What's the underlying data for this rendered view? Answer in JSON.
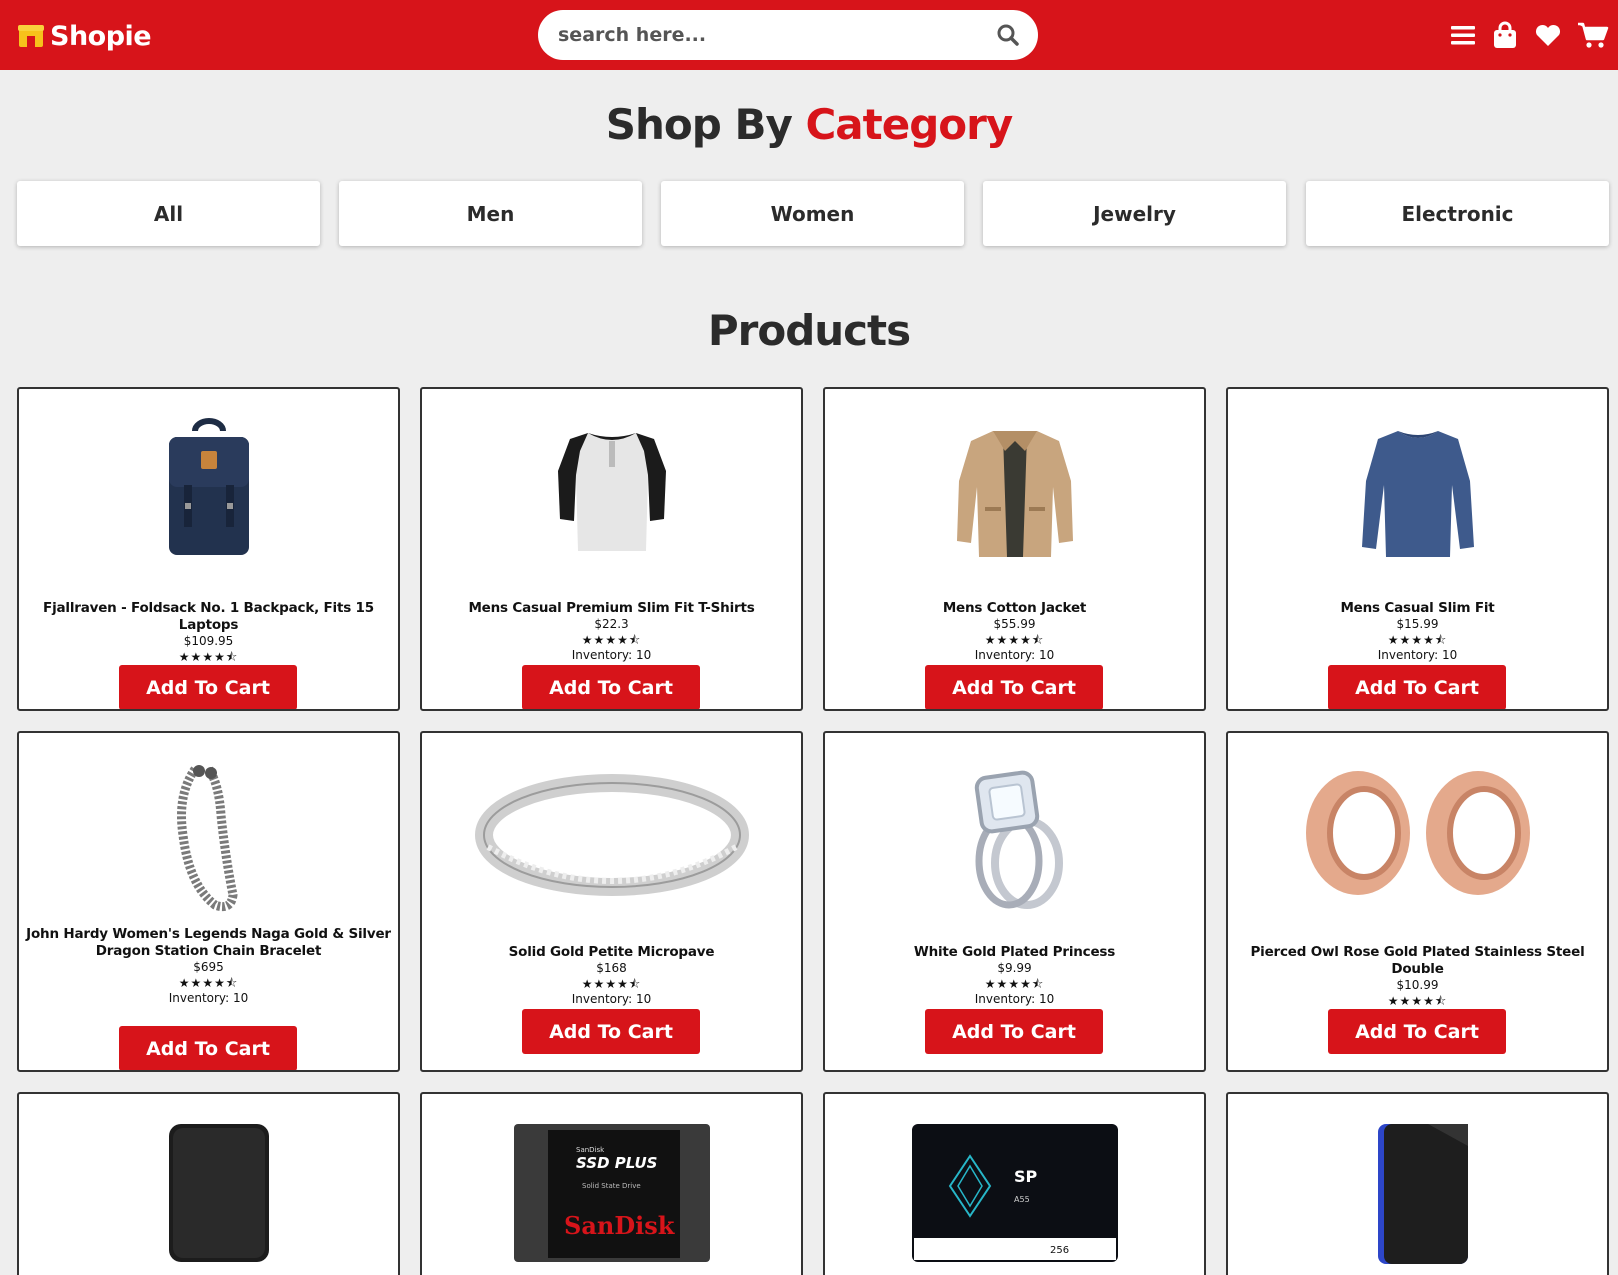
{
  "header": {
    "logo_text": "Shopie",
    "search_placeholder": "search here..."
  },
  "colors": {
    "brand": "#d7141a",
    "background": "#eeeeee",
    "card_border": "#333333"
  },
  "icons": [
    "shop-logo-icon",
    "search-icon",
    "menu-icon",
    "shopping-bag-icon",
    "heart-icon",
    "cart-icon"
  ],
  "category_section": {
    "title_main": "Shop By",
    "title_accent": "Category",
    "categories": [
      "All",
      "Men",
      "Women",
      "Jewelry",
      "Electronic"
    ]
  },
  "products_section": {
    "title": "Products",
    "add_label": "Add To Cart",
    "items": [
      {
        "name": "Fjallraven - Foldsack No. 1 Backpack, Fits 15 Laptops",
        "price": "$109.95",
        "stars": "★★★★⯪",
        "inventory": "Inventory: 10",
        "image": "backpack"
      },
      {
        "name": "Mens Casual Premium Slim Fit T-Shirts",
        "price": "$22.3",
        "stars": "★★★★⯪",
        "inventory": "Inventory: 10",
        "image": "henley-shirt"
      },
      {
        "name": "Mens Cotton Jacket",
        "price": "$55.99",
        "stars": "★★★★⯪",
        "inventory": "Inventory: 10",
        "image": "jacket"
      },
      {
        "name": "Mens Casual Slim Fit",
        "price": "$15.99",
        "stars": "★★★★⯪",
        "inventory": "Inventory: 10",
        "image": "long-sleeve-shirt"
      },
      {
        "name": "John Hardy Women's Legends Naga Gold & Silver Dragon Station Chain Bracelet",
        "price": "$695",
        "stars": "★★★★⯪",
        "inventory": "Inventory: 10",
        "image": "bracelet"
      },
      {
        "name": "Solid Gold Petite Micropave",
        "price": "$168",
        "stars": "★★★★⯪",
        "inventory": "Inventory: 10",
        "image": "ring-band"
      },
      {
        "name": "White Gold Plated Princess",
        "price": "$9.99",
        "stars": "★★★★⯪",
        "inventory": "Inventory: 10",
        "image": "diamond-ring"
      },
      {
        "name": "Pierced Owl Rose Gold Plated Stainless Steel Double",
        "price": "$10.99",
        "stars": "★★★★⯪",
        "inventory": "Inventory: 10",
        "image": "ear-plugs"
      },
      {
        "image": "external-hard-drive"
      },
      {
        "image": "sandisk-ssd",
        "brand_top": "SanDisk",
        "model": "SSD PLUS",
        "subtitle": "Solid State Drive",
        "brand": "SanDisk"
      },
      {
        "image": "sp-ssd",
        "brand": "SP",
        "model": "A55",
        "capacity": "256"
      },
      {
        "image": "wd-gaming-drive"
      }
    ]
  }
}
